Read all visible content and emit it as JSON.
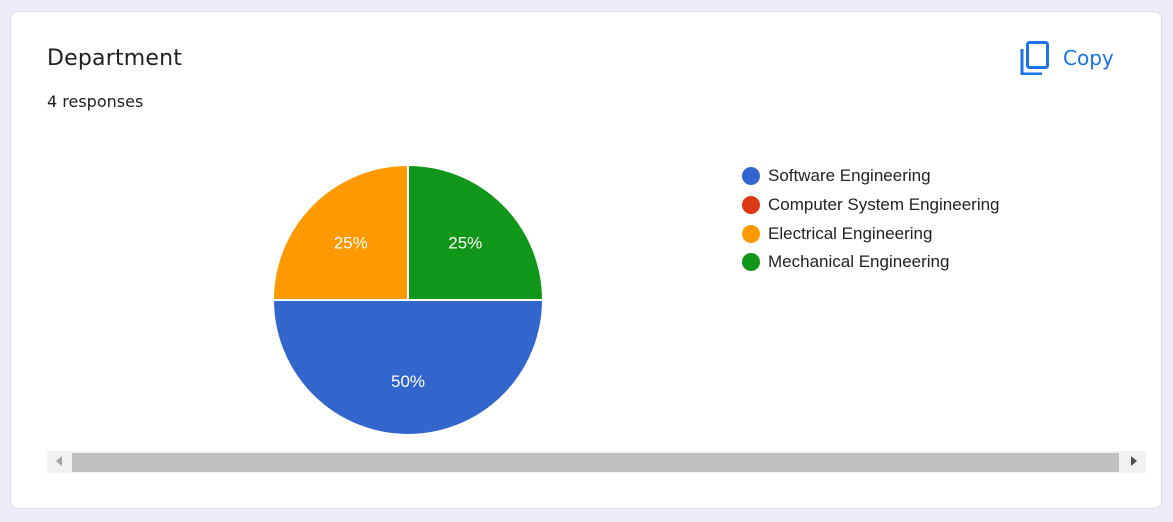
{
  "card": {
    "title": "Department",
    "responses": "4 responses",
    "copy_label": "Copy",
    "copy_icon": "copy-icon"
  },
  "colors": {
    "accent": "#1a73e8",
    "software": "#3366cc",
    "computer_system": "#dc3912",
    "electrical": "#ff9900",
    "mechanical": "#109618"
  },
  "chart_data": {
    "type": "pie",
    "categories": [
      "Software Engineering",
      "Computer System Engineering",
      "Electrical Engineering",
      "Mechanical Engineering"
    ],
    "values": [
      2,
      0,
      1,
      1
    ],
    "percent_labels": [
      "50%",
      "",
      "25%",
      "25%"
    ],
    "colors": [
      "#3366cc",
      "#dc3912",
      "#ff9900",
      "#109618"
    ],
    "legend_position": "right"
  },
  "scrollbar": {
    "left_icon": "arrow-left-icon",
    "right_icon": "arrow-right-icon"
  }
}
